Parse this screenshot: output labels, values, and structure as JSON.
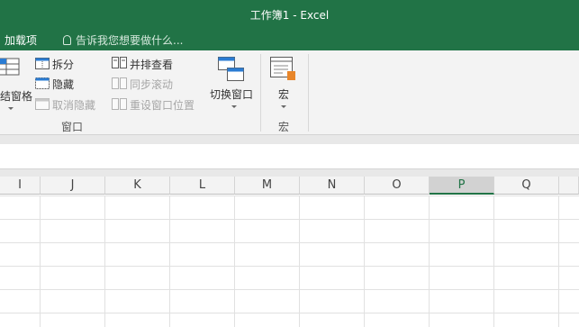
{
  "window": {
    "title": "工作簿1 - Excel"
  },
  "tabs": {
    "addins": "加载项",
    "tellme": "告诉我您想要做什么..."
  },
  "ribbon": {
    "window_group": {
      "freeze_panes": "结窗格",
      "split": "拆分",
      "hide": "隐藏",
      "unhide": "取消隐藏",
      "view_side_by_side": "并排查看",
      "sync_scroll": "同步滚动",
      "reset_position": "重设窗口位置",
      "switch_windows": "切换窗口",
      "label": "窗口"
    },
    "macros_group": {
      "macros": "宏",
      "label": "宏"
    }
  },
  "grid": {
    "columns": [
      "I",
      "J",
      "K",
      "L",
      "M",
      "N",
      "O",
      "P",
      "Q"
    ],
    "active_column": "P"
  },
  "colors": {
    "accent": "#217346"
  }
}
